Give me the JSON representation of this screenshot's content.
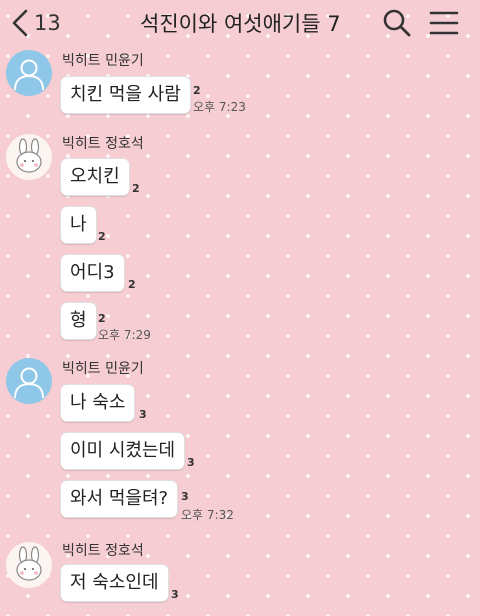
{
  "header": {
    "back_count": "13",
    "title": "석진이와 여섯애기들 7",
    "back_icon": "chevron-left-icon",
    "search_icon": "search-icon",
    "menu_icon": "hamburger-menu-icon"
  },
  "colors": {
    "background": "#f6cdd3",
    "bubble": "#ffffff",
    "default_avatar": "#8fc7e8"
  },
  "messages": [
    {
      "sender": "빅히트 민윤기",
      "avatar": "default-profile-icon",
      "items": [
        {
          "text": "치킨 먹을 사람",
          "unread": "2",
          "time": "오후 7:23"
        }
      ]
    },
    {
      "sender": "빅히트 정호석",
      "avatar": "bunny-profile-icon",
      "items": [
        {
          "text": "오치킨",
          "unread": "2"
        },
        {
          "text": "나",
          "unread": "2"
        },
        {
          "text": "어디3",
          "unread": "2"
        },
        {
          "text": "형",
          "unread": "2",
          "time": "오후 7:29"
        }
      ]
    },
    {
      "sender": "빅히트 민윤기",
      "avatar": "default-profile-icon",
      "items": [
        {
          "text": "나 숙소",
          "unread": "3"
        },
        {
          "text": "이미 시켰는데",
          "unread": "3"
        },
        {
          "text": "와서 먹을텨?",
          "unread": "3",
          "time": "오후 7:32"
        }
      ]
    },
    {
      "sender": "빅히트 정호석",
      "avatar": "bunny-profile-icon",
      "items": [
        {
          "text": "저 숙소인데",
          "unread": "3"
        }
      ]
    }
  ]
}
